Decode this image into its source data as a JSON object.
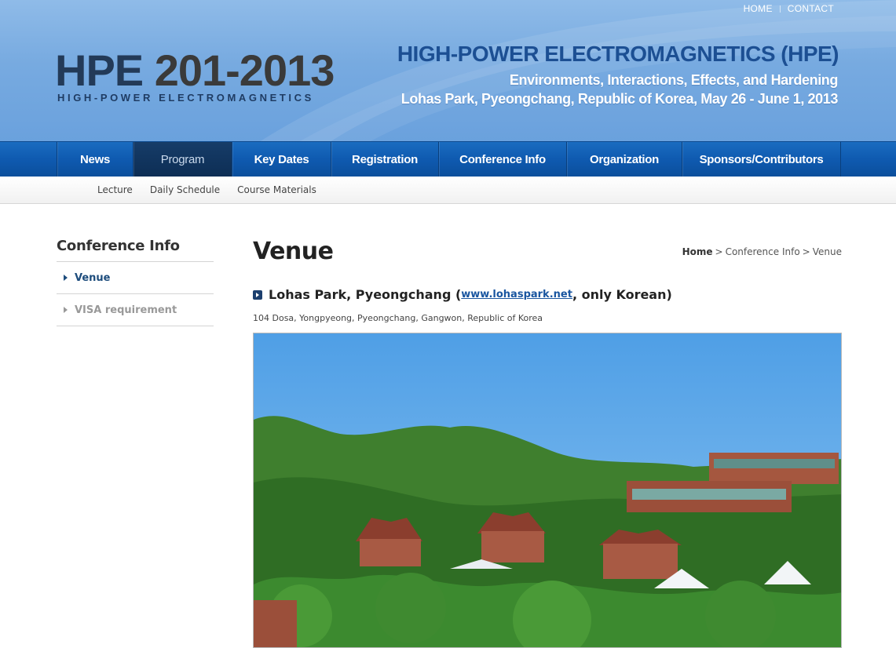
{
  "header": {
    "top_links": [
      "HOME",
      "CONTACT"
    ],
    "logo_prefix": "HPE",
    "logo_year": "201-2013",
    "logo_sub": "HIGH-POWER ELECTROMAGNETICS",
    "conf_title": "HIGH-POWER ELECTROMAGNETICS (HPE)",
    "conf_line1": "Environments, Interactions, Effects, and Hardening",
    "conf_line2": "Lohas Park, Pyeongchang, Republic of Korea,  May 26 - June 1, 2013"
  },
  "nav": {
    "items": [
      "News",
      "Program",
      "Key Dates",
      "Registration",
      "Conference Info",
      "Organization",
      "Sponsors/Contributors"
    ],
    "active": "Program"
  },
  "subnav": {
    "items": [
      "Lecture",
      "Daily Schedule",
      "Course Materials"
    ]
  },
  "sidebar": {
    "title": "Conference Info",
    "items": [
      "Venue",
      "VISA requirement"
    ],
    "active": "Venue"
  },
  "content": {
    "title": "Venue",
    "breadcrumb": [
      "Home",
      "Conference Info",
      "Venue"
    ],
    "venue_name": "Lohas Park, Pyeongchang (",
    "venue_link": "www.lohaspark.net",
    "venue_suffix": ", only Korean)",
    "address": "104 Dosa, Yongpyeong, Pyeongchang, Gangwon, Republic of Korea"
  },
  "colors": {
    "header_blue": "#77aae0",
    "nav_blue": "#0f5ab0",
    "nav_active": "#0d2e55",
    "title_blue": "#1c4f93",
    "link_blue": "#1a56a0"
  }
}
